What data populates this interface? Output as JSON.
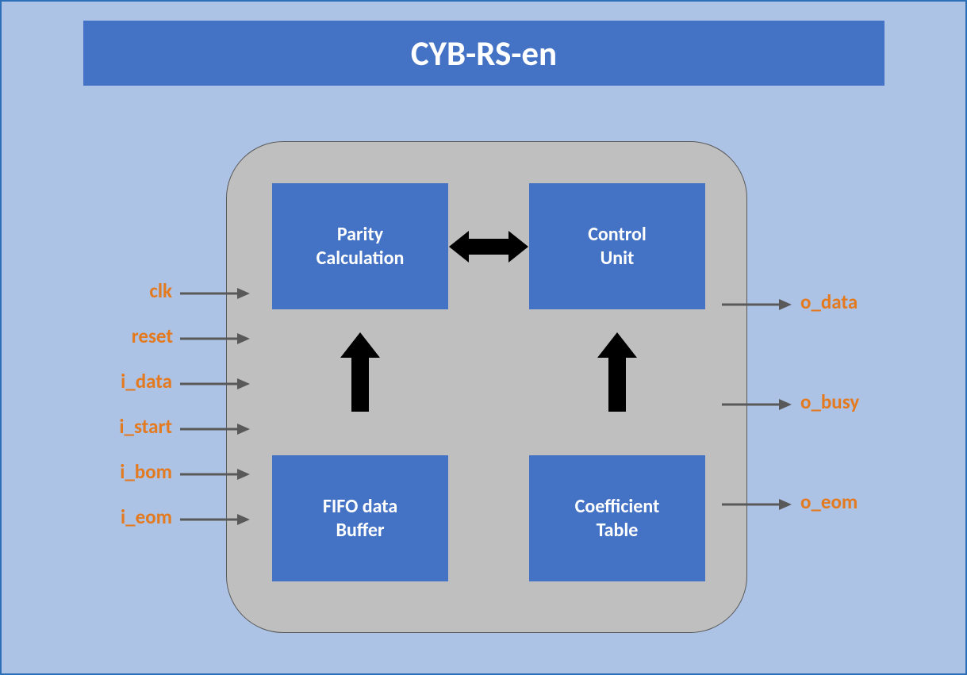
{
  "title": "CYB-RS-en",
  "blocks": {
    "parity": {
      "l1": "Parity",
      "l2": "Calculation"
    },
    "control": {
      "l1": "Control",
      "l2": "Unit"
    },
    "fifo": {
      "l1": "FIFO data",
      "l2": "Buffer"
    },
    "coeff": {
      "l1": "Coefficient",
      "l2": "Table"
    }
  },
  "inputs": [
    "clk",
    "reset",
    "i_data",
    "i_start",
    "i_bom",
    "i_eom"
  ],
  "outputs": [
    "o_data",
    "o_busy",
    "o_eom"
  ]
}
